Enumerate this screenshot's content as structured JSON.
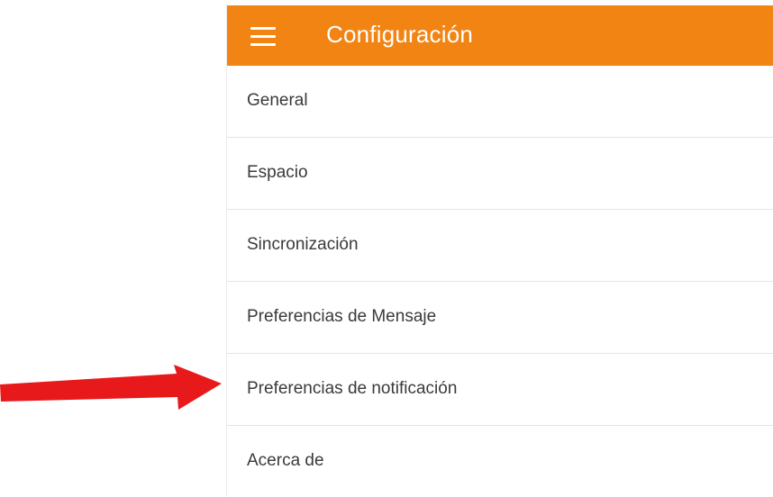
{
  "app": {
    "title": "Configuración",
    "accent_color": "#f28414",
    "menu_icon": "hamburger-menu-icon"
  },
  "settings": {
    "items": [
      {
        "label": "General"
      },
      {
        "label": "Espacio"
      },
      {
        "label": "Sincronización"
      },
      {
        "label": "Preferencias de Mensaje"
      },
      {
        "label": "Preferencias de notificación"
      },
      {
        "label": "Acerca de"
      }
    ]
  },
  "annotation": {
    "arrow_color": "#e8191b",
    "points_to": "Preferencias de notificación"
  }
}
